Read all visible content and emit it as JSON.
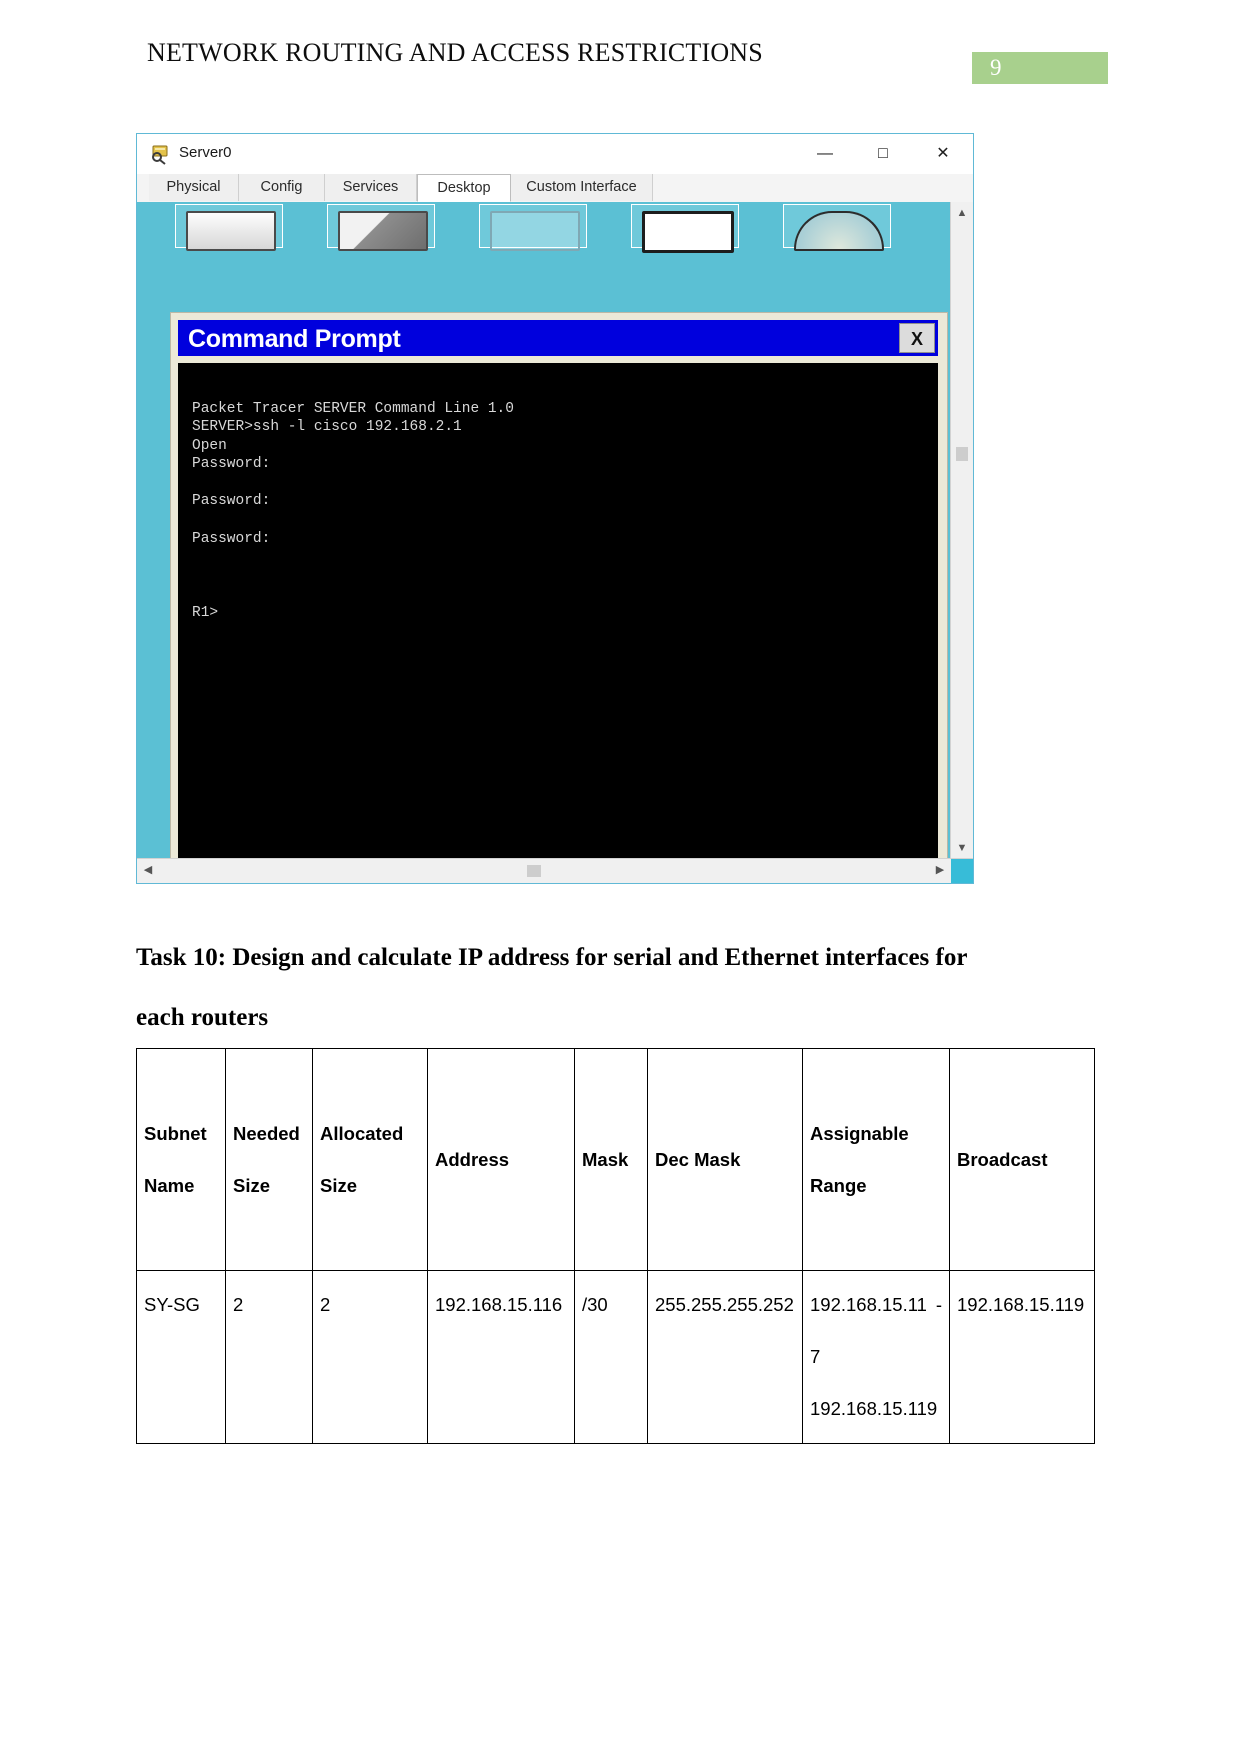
{
  "document": {
    "header_title": "NETWORK ROUTING AND ACCESS RESTRICTIONS",
    "page_number": "9",
    "page_badge_color": "#a8d08d",
    "task_heading": "Task 10: Design and calculate IP address for serial and Ethernet interfaces for each routers"
  },
  "packet_tracer_window": {
    "title": "Server0",
    "app_icon": "packet-tracer-server-icon",
    "window_buttons": {
      "minimize": "—",
      "maximize": "□",
      "close": "✕"
    },
    "tabs": [
      {
        "label": "Physical",
        "active": false
      },
      {
        "label": "Config",
        "active": false
      },
      {
        "label": "Services",
        "active": false
      },
      {
        "label": "Desktop",
        "active": true
      },
      {
        "label": "Custom Interface",
        "active": false
      }
    ],
    "desktop_background_color": "#5bc0d4",
    "scrollbars": {
      "up_arrow": "▲",
      "down_arrow": "▼",
      "left_arrow": "◀",
      "right_arrow": "▶"
    }
  },
  "command_prompt": {
    "title": "Command Prompt",
    "titlebar_color": "#0000dd",
    "close_label": "X",
    "screen_background": "#000000",
    "terminal_lines": "Packet Tracer SERVER Command Line 1.0\nSERVER>ssh -l cisco 192.168.2.1\nOpen\nPassword:\n\nPassword:\n\nPassword:\n\n\n\nR1>"
  },
  "ip_table": {
    "headers": [
      "Subnet Name",
      "Needed Size",
      "Allocated Size",
      "Address",
      "Mask",
      "Dec Mask",
      "Assignable Range",
      "Broadcast"
    ],
    "rows": [
      {
        "subnet_name": "SY-SG",
        "needed_size": "2",
        "allocated_size": "2",
        "address": "192.168.15.116",
        "mask": "/30",
        "dec_mask": "255.255.255.252",
        "assignable_range_start": "192.168.15.117",
        "assignable_range_dash": "-",
        "assignable_range_end": "192.168.15.119",
        "broadcast": "192.168.15.119"
      }
    ]
  }
}
